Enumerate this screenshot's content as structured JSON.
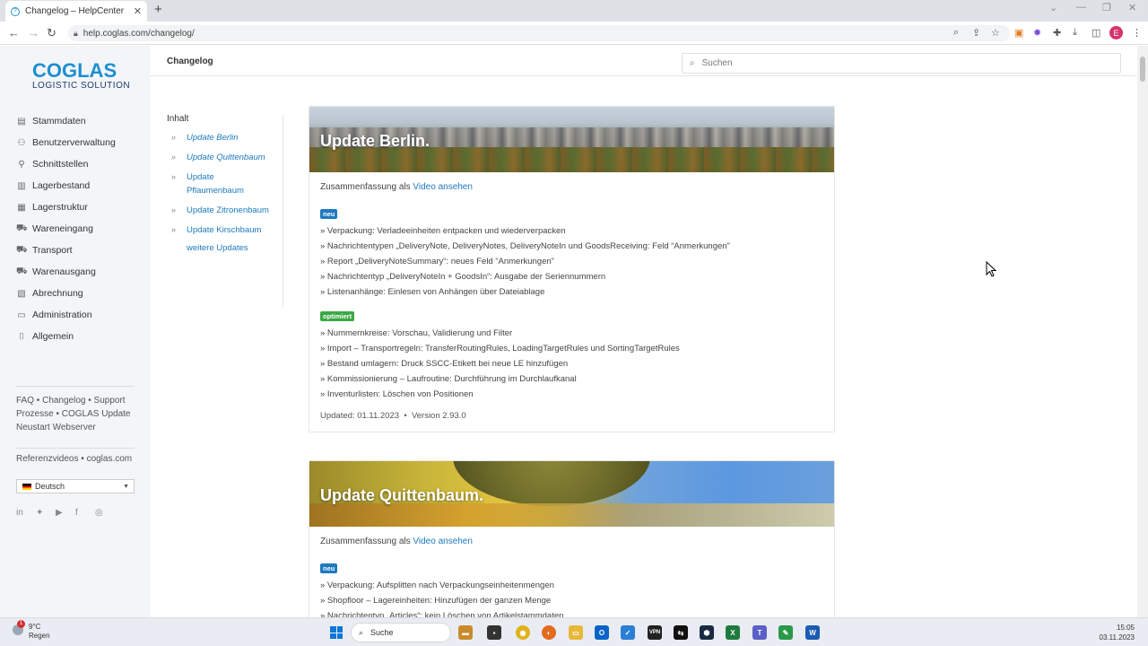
{
  "browser": {
    "tab_title": "Changelog – HelpCenter",
    "tab_close": "✕",
    "new_tab": "+",
    "url": "help.coglas.com/changelog/",
    "profile_initial": "E"
  },
  "brand": {
    "name": "COGLAS",
    "tagline": "LOGISTIC SOLUTION"
  },
  "sidebar": {
    "items": [
      {
        "label": "Stammdaten",
        "icon": "document-icon",
        "glyph": "▤"
      },
      {
        "label": "Benutzerverwaltung",
        "icon": "users-icon",
        "glyph": "⚇"
      },
      {
        "label": "Schnittstellen",
        "icon": "plug-icon",
        "glyph": "⚲"
      },
      {
        "label": "Lagerbestand",
        "icon": "stock-icon",
        "glyph": "▥"
      },
      {
        "label": "Lagerstruktur",
        "icon": "structure-icon",
        "glyph": "▦"
      },
      {
        "label": "Wareneingang",
        "icon": "inbound-icon",
        "glyph": "⛟"
      },
      {
        "label": "Transport",
        "icon": "transport-icon",
        "glyph": "⛟"
      },
      {
        "label": "Warenausgang",
        "icon": "outbound-icon",
        "glyph": "⛟"
      },
      {
        "label": "Abrechnung",
        "icon": "billing-icon",
        "glyph": "▧"
      },
      {
        "label": "Administration",
        "icon": "admin-icon",
        "glyph": "▭"
      },
      {
        "label": "Allgemein",
        "icon": "bookmark-icon",
        "glyph": "⌷"
      }
    ],
    "footer_links": [
      "FAQ",
      "Changelog",
      "Support",
      "Prozesse",
      "COGLAS Update",
      "Neustart Webserver"
    ],
    "ref_links": [
      "Referenzvideos",
      "coglas.com"
    ],
    "language": "Deutsch",
    "bullet": "•"
  },
  "header": {
    "page_title": "Changelog",
    "search_placeholder": "Suchen"
  },
  "toc": {
    "heading": "Inhalt",
    "items": [
      {
        "label": "Update Berlin"
      },
      {
        "label": "Update Quittenbaum"
      },
      {
        "label": "Update Pflaumenbaum"
      },
      {
        "label": "Update Zitronenbaum"
      },
      {
        "label": "Update Kirschbaum"
      }
    ],
    "more": "weitere Updates"
  },
  "updates": [
    {
      "title": "Update Berlin.",
      "summary_prefix": "Zusammenfassung als",
      "summary_link": "Video ansehen",
      "groups": [
        {
          "badge": "neu",
          "lines": [
            "» Verpackung: Verladeeinheiten entpacken und wiederverpacken",
            "» Nachrichtentypen „DeliveryNote, DeliveryNotes, DeliveryNoteIn und GoodsReceiving: Feld “Anmerkungen”",
            "» Report „DeliveryNoteSummary“: neues Feld “Anmerkungen”",
            "» Nachrichtentyp „DeliveryNoteIn + GoodsIn“: Ausgabe der Seriennummern",
            "» Listenanhänge: Einlesen von Anhängen über Dateiablage"
          ]
        },
        {
          "badge": "optimiert",
          "lines": [
            "» Nummernkreise: Vorschau, Validierung und Filter",
            "» Import – Transportregeln: TransferRoutingRules, LoadingTargetRules und SortingTargetRules",
            "» Bestand umlagern: Druck SSCC-Etikett bei neue LE hinzufügen",
            "» Kommissionierung – Laufroutine: Durchführung im Durchlaufkanal",
            "» Inventurlisten: Löschen von Positionen"
          ]
        }
      ],
      "updated": "Updated: 01.11.2023",
      "version": "Version 2.93.0"
    },
    {
      "title": "Update Quittenbaum.",
      "summary_prefix": "Zusammenfassung als",
      "summary_link": "Video ansehen",
      "groups": [
        {
          "badge": "neu",
          "lines": [
            "» Verpackung: Aufsplitten nach Verpackungseinheitenmengen",
            "» Shopfloor – Lagereinheiten: Hinzufügen der ganzen Menge",
            "» Nachrichtentyp „Articles“: kein Löschen von Artikelstammdaten"
          ]
        }
      ]
    }
  ],
  "taskbar": {
    "temperature": "9°C",
    "weather": "Regen",
    "notification_count": "1",
    "search_label": "Suche",
    "vpn_label": "VPN",
    "time": "15:05",
    "date": "03.11.2023"
  },
  "colors": {
    "accent": "#1e8fd0",
    "link": "#1e79bf",
    "badge_new": "#1e79bf",
    "badge_optimized": "#3aa845"
  }
}
